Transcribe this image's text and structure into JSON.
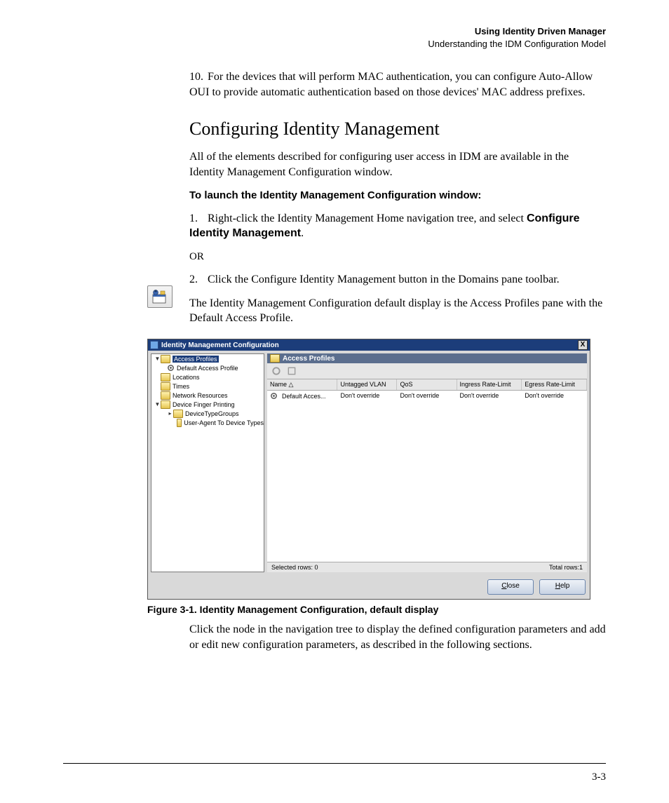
{
  "header": {
    "title_bold": "Using Identity Driven Manager",
    "subtitle": "Understanding the IDM Configuration Model"
  },
  "intro": {
    "item10_num": "10.",
    "item10_text": "For the devices that will perform MAC authentication, you can configure Auto-Allow OUI to provide automatic authentication based on those devices' MAC address prefixes."
  },
  "section": {
    "heading": "Configuring Identity Management",
    "para1": "All of the elements described for configuring user access in IDM are available in the Identity Management Configuration window.",
    "launch_bold": "To launch the Identity Management Configuration window:",
    "step1_num": "1.",
    "step1_text_a": "Right-click the Identity Management Home navigation tree, and select ",
    "step1_text_b": "Configure Identity Management",
    "step1_text_c": ".",
    "or_text": "OR",
    "step2_num": "2.",
    "step2_text": "Click the Configure Identity Management button in the Domains pane toolbar.",
    "para2": "The Identity Management Configuration default display is the Access Profiles pane with the Default Access Profile."
  },
  "screenshot": {
    "title": "Identity Management Configuration",
    "close": "X",
    "tree": {
      "access_profiles": "Access Profiles",
      "default_access_profile": "Default Access Profile",
      "locations": "Locations",
      "times": "Times",
      "network_resources": "Network Resources",
      "device_finger_printing": "Device Finger Printing",
      "device_type_groups": "DeviceTypeGroups",
      "user_agent_to_device_types": "User-Agent To Device Types"
    },
    "pane_title": "Access Profiles",
    "columns": {
      "name": "Name  △",
      "untagged_vlan": "Untagged VLAN",
      "qos": "QoS",
      "ingress": "Ingress Rate-Limit",
      "egress": "Egress Rate-Limit"
    },
    "rows": [
      {
        "name": "Default Acces...",
        "untagged_vlan": "Don't override",
        "qos": "Don't override",
        "ingress": "Don't override",
        "egress": "Don't override"
      }
    ],
    "status_left": "Selected rows: 0",
    "status_right": "Total rows:1",
    "buttons": {
      "close_u": "C",
      "close_rest": "lose",
      "help_u": "H",
      "help_rest": "elp"
    }
  },
  "figure_caption": "Figure 3-1.  Identity Management Configuration, default display",
  "closing_para": "Click the node in the navigation tree to display the defined configuration parameters and add or edit new configuration parameters, as described in the following sections.",
  "page_number": "3-3"
}
